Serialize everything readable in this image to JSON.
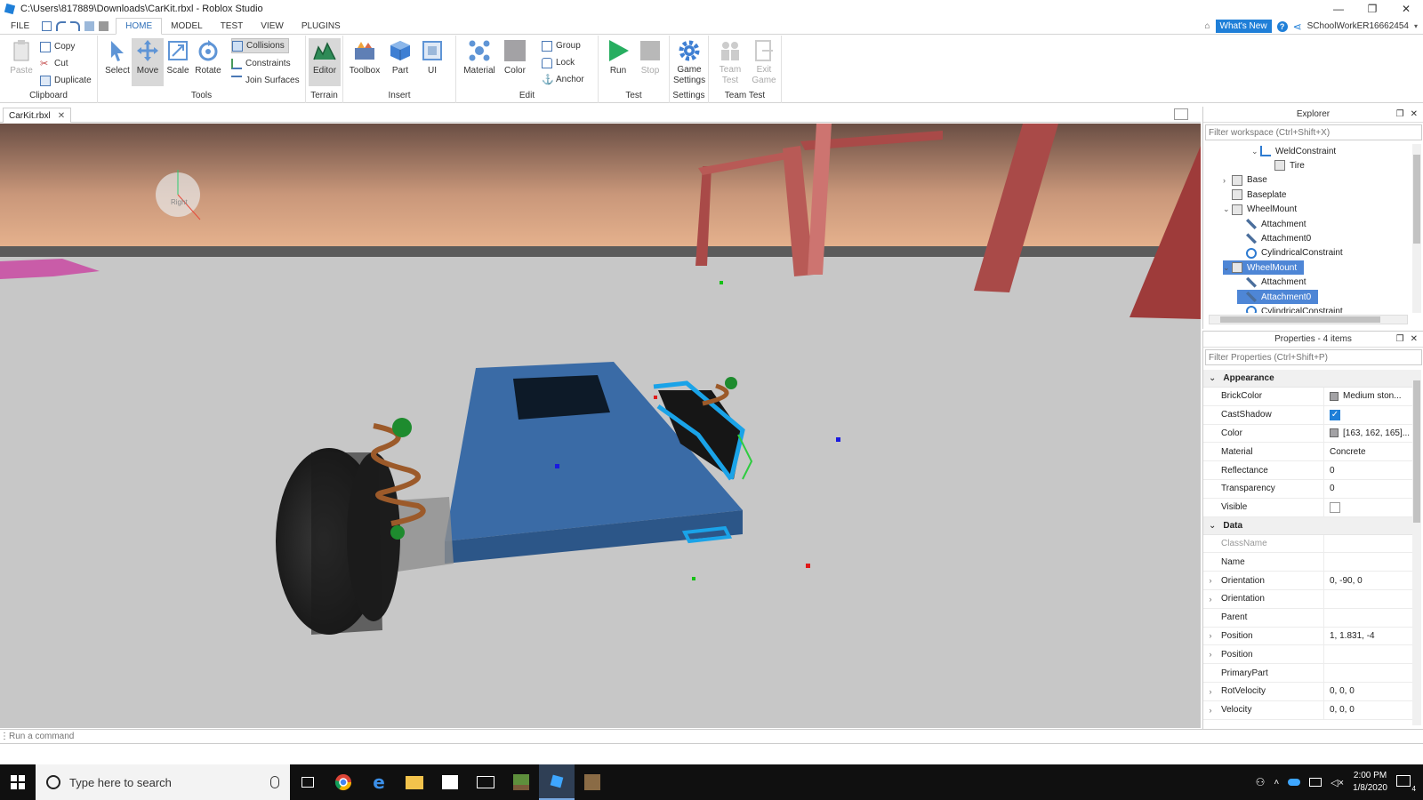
{
  "window": {
    "title": "C:\\Users\\817889\\Downloads\\CarKit.rbxl - Roblox Studio",
    "buttons": [
      "—",
      "❐",
      "✕"
    ]
  },
  "menubar": {
    "file": "FILE",
    "tabs": [
      "HOME",
      "MODEL",
      "TEST",
      "VIEW",
      "PLUGINS"
    ],
    "active_tab": "HOME",
    "whats_new": "What's New",
    "help": "?",
    "username": "SChoolWorkER16662454"
  },
  "ribbon": {
    "clipboard": {
      "label": "Clipboard",
      "paste": "Paste",
      "copy": "Copy",
      "cut": "Cut",
      "duplicate": "Duplicate"
    },
    "tools": {
      "label": "Tools",
      "select": "Select",
      "move": "Move",
      "scale": "Scale",
      "rotate": "Rotate",
      "collisions": "Collisions",
      "constraints": "Constraints",
      "join_surfaces": "Join Surfaces"
    },
    "terrain": {
      "label": "Terrain",
      "editor": "Editor"
    },
    "insert": {
      "label": "Insert",
      "toolbox": "Toolbox",
      "part": "Part",
      "ui": "UI"
    },
    "edit": {
      "label": "Edit",
      "material": "Material",
      "color": "Color",
      "group": "Group",
      "lock": "Lock",
      "anchor": "Anchor"
    },
    "test": {
      "label": "Test",
      "run": "Run",
      "stop": "Stop"
    },
    "settings": {
      "label": "Settings",
      "game_settings_1": "Game",
      "game_settings_2": "Settings"
    },
    "team_test": {
      "label": "Team Test",
      "team_1": "Team",
      "team_2": "Test",
      "exit_1": "Exit",
      "exit_2": "Game"
    }
  },
  "doc_tab": {
    "name": "CarKit.rbxl",
    "close": "✕"
  },
  "viewport": {
    "view_cube_label": "Right"
  },
  "explorer": {
    "title": "Explorer",
    "filter_placeholder": "Filter workspace (Ctrl+Shift+X)",
    "items": [
      {
        "label": "WeldConstraint",
        "indent": 3,
        "arrow": "⌄",
        "icon": "weld-icon"
      },
      {
        "label": "Tire",
        "indent": 4,
        "arrow": "",
        "icon": "part-icon"
      },
      {
        "label": "Base",
        "indent": 1,
        "arrow": "›",
        "icon": "part-icon"
      },
      {
        "label": "Baseplate",
        "indent": 1,
        "arrow": "",
        "icon": "part-icon"
      },
      {
        "label": "WheelMount",
        "indent": 1,
        "arrow": "⌄",
        "icon": "part-icon"
      },
      {
        "label": "Attachment",
        "indent": 2,
        "arrow": "",
        "icon": "attachment-icon"
      },
      {
        "label": "Attachment0",
        "indent": 2,
        "arrow": "",
        "icon": "attachment-icon"
      },
      {
        "label": "CylindricalConstraint",
        "indent": 2,
        "arrow": "",
        "icon": "constraint-icon"
      },
      {
        "label": "WheelMount",
        "indent": 1,
        "arrow": "⌄",
        "icon": "part-icon",
        "selected": true
      },
      {
        "label": "Attachment",
        "indent": 2,
        "arrow": "",
        "icon": "attachment-icon"
      },
      {
        "label": "Attachment0",
        "indent": 2,
        "arrow": "",
        "icon": "attachment-icon",
        "selected": true
      },
      {
        "label": "CylindricalConstraint",
        "indent": 2,
        "arrow": "",
        "icon": "constraint-icon"
      }
    ]
  },
  "properties": {
    "title": "Properties - 4 items",
    "filter_placeholder": "Filter Properties (Ctrl+Shift+P)",
    "appearance_label": "Appearance",
    "data_label": "Data",
    "appearance": [
      {
        "name": "BrickColor",
        "value": "Medium ston...",
        "swatch": "#a3a2a5"
      },
      {
        "name": "CastShadow",
        "value": "",
        "checkbox": "checked"
      },
      {
        "name": "Color",
        "value": "[163, 162, 165]...",
        "swatch": "#a3a2a5"
      },
      {
        "name": "Material",
        "value": "Concrete"
      },
      {
        "name": "Reflectance",
        "value": "0"
      },
      {
        "name": "Transparency",
        "value": "0"
      },
      {
        "name": "Visible",
        "value": "",
        "checkbox": "unchecked"
      }
    ],
    "data": [
      {
        "name": "ClassName",
        "value": "",
        "muted": true
      },
      {
        "name": "Name",
        "value": ""
      },
      {
        "name": "Orientation",
        "value": "0, -90, 0",
        "expandable": true
      },
      {
        "name": "Orientation",
        "value": "",
        "expandable": true
      },
      {
        "name": "Parent",
        "value": ""
      },
      {
        "name": "Position",
        "value": "1, 1.831, -4",
        "expandable": true
      },
      {
        "name": "Position",
        "value": "",
        "expandable": true
      },
      {
        "name": "PrimaryPart",
        "value": ""
      },
      {
        "name": "RotVelocity",
        "value": "0, 0, 0",
        "expandable": true
      },
      {
        "name": "Velocity",
        "value": "0, 0, 0",
        "expandable": true
      }
    ]
  },
  "command_bar": {
    "placeholder": "Run a command"
  },
  "taskbar": {
    "search_placeholder": "Type here to search",
    "time": "2:00 PM",
    "date": "1/8/2020",
    "notifications": "4"
  },
  "colors": {
    "accent": "#1f7fd8",
    "selection": "#4e86d6",
    "sky_top": "#6a4e44",
    "sky_bottom": "#e8b48f",
    "floor": "#c7c7c7",
    "car_body": "#3a6ba6"
  }
}
